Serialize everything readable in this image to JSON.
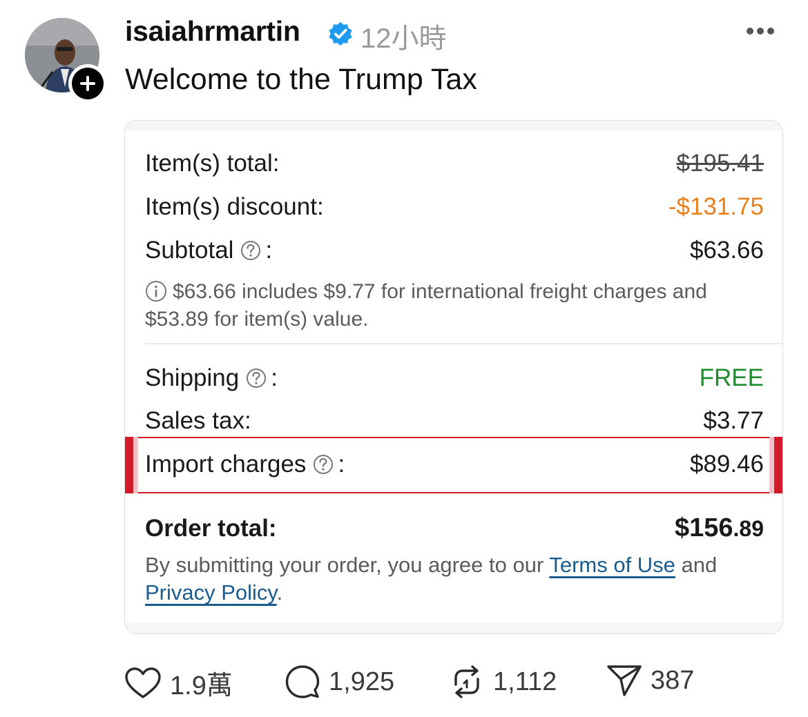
{
  "post": {
    "username": "isaiahrmartin",
    "timestamp": "12小時",
    "text": "Welcome to the Trump Tax"
  },
  "receipt": {
    "items_total_label": "Item(s) total:",
    "items_total_value": "$195.41",
    "items_discount_label": "Item(s) discount:",
    "items_discount_value": "-$131.75",
    "subtotal_label": "Subtotal",
    "subtotal_value": "$63.66",
    "subtotal_note": "$63.66 includes $9.77 for international freight charges and $53.89 for item(s) value.",
    "shipping_label": "Shipping",
    "shipping_value": "FREE",
    "sales_tax_label": "Sales tax:",
    "sales_tax_value": "$3.77",
    "import_label": "Import charges",
    "import_value": "$89.46",
    "order_total_label": "Order total:",
    "order_total_dollars": "$156",
    "order_total_cents": ".89",
    "legal_prefix": "By submitting your order, you agree to our",
    "terms_link": "Terms of Use",
    "legal_and": "and",
    "privacy_link": "Privacy Policy",
    "legal_suffix": ".",
    "colon": ":",
    "colors": {
      "discount": "#e8801d",
      "free": "#1f8a2e",
      "highlight": "#d11a2a",
      "link": "#1b5c8e"
    }
  },
  "actions": {
    "likes": "1.9萬",
    "replies": "1,925",
    "reposts": "1,112",
    "shares": "387"
  },
  "icons": [
    "verified-badge-icon",
    "more-icon",
    "plus-icon",
    "help-icon",
    "info-icon",
    "heart-icon",
    "comment-icon",
    "repost-icon",
    "send-icon"
  ]
}
